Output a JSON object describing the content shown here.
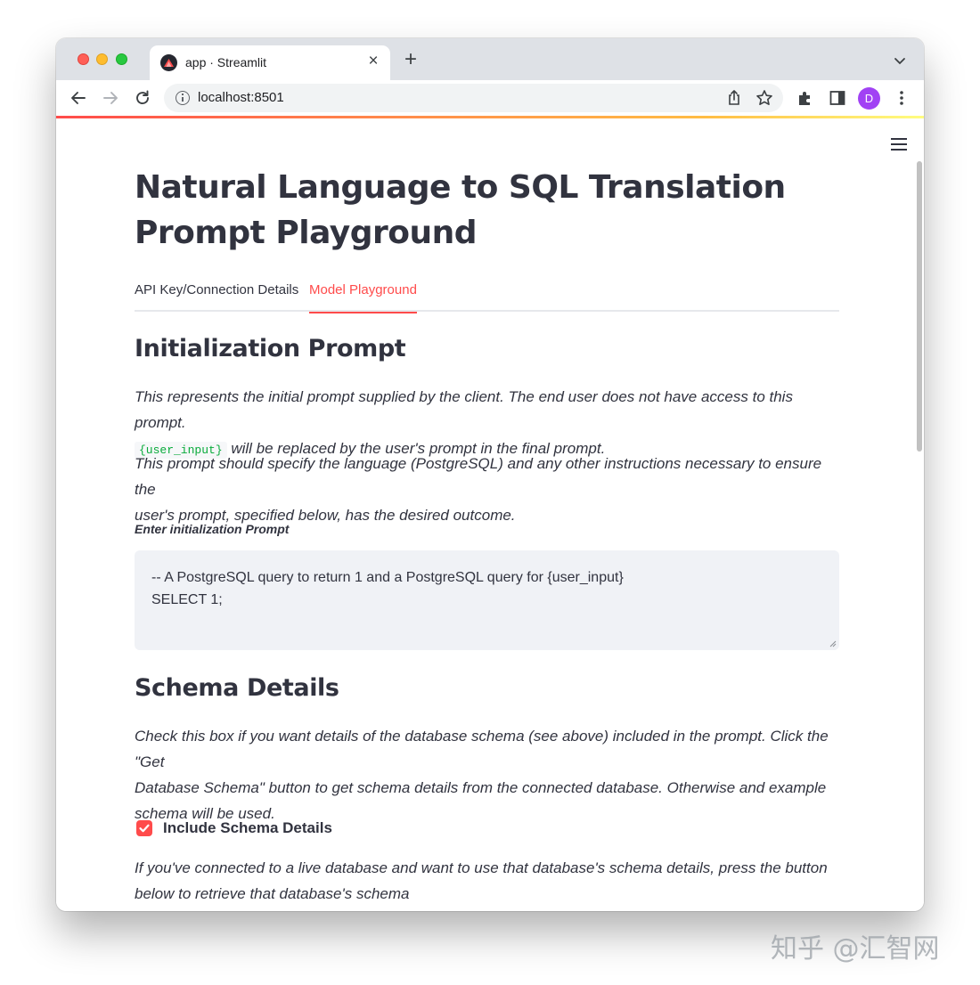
{
  "browser": {
    "tab_title": "app · Streamlit",
    "tab_close": "×",
    "new_tab": "+",
    "url": "localhost:8501",
    "profile_initial": "D",
    "accent_colors": {
      "close": "#ff5f57",
      "minimize": "#febc2e",
      "maximize": "#28c840",
      "profile": "#a142f4"
    }
  },
  "app": {
    "title_line1": "Natural Language to SQL Translation",
    "title_line2": "Prompt Playground",
    "tabs": [
      {
        "label": "API Key/Connection Details",
        "active": false
      },
      {
        "label": "Model Playground",
        "active": true
      }
    ],
    "init_section": {
      "heading": "Initialization Prompt",
      "para1_line1": "This represents the initial prompt supplied by the client. The end user does not have access to this prompt.",
      "para1_code": "{user_input}",
      "para1_line2_rest": " will be replaced by the user's prompt in the final prompt.",
      "para2_line1": "This prompt should specify the language (PostgreSQL) and any other instructions necessary to ensure the",
      "para2_line2": "user's prompt, specified below, has the desired outcome.",
      "field_label": "Enter initialization Prompt",
      "prompt_lines": [
        "-- A PostgreSQL query to return 1 and a PostgreSQL query for {user_input}",
        "SELECT 1;"
      ]
    },
    "schema_section": {
      "heading": "Schema Details",
      "para1_line1": "Check this box if you want details of the database schema (see above) included in the prompt. Click the \"Get",
      "para1_line2": "Database Schema\" button to get schema details from the connected database. Otherwise and example",
      "para1_line3": "schema will be used.",
      "checkbox_label": "Include Schema Details",
      "checkbox_checked": true,
      "para2_line1": "If you've connected to a live database and want to use that database's schema details, press the button",
      "para2_line2": "below to retrieve that database's schema"
    },
    "accent_color": "#ff4b4b"
  },
  "watermark": "知乎 @汇智网"
}
